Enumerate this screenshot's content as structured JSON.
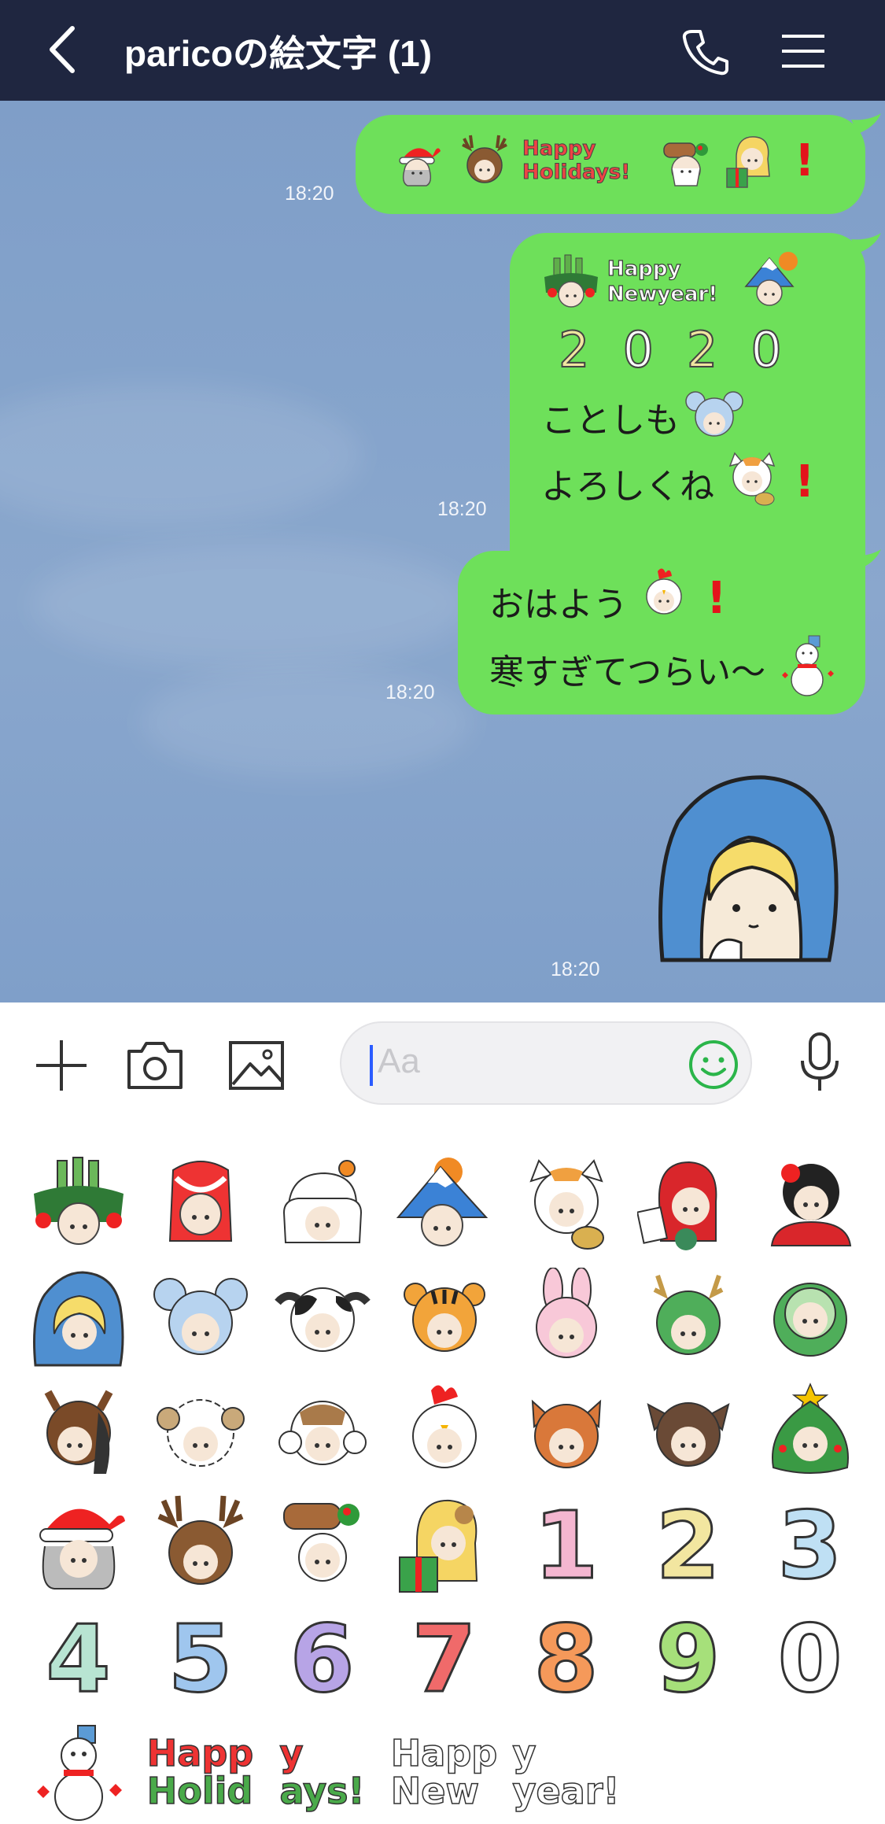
{
  "header": {
    "title": "paricoの絵文字 (1)",
    "back_icon": "chevron-left-icon",
    "call_icon": "phone-icon",
    "menu_icon": "hamburger-menu-icon"
  },
  "messages": [
    {
      "time": "18:20",
      "banner": "Happy Holidays!"
    },
    {
      "time": "18:20",
      "banner": "Happy Newyear!",
      "year": [
        "2",
        "0",
        "2",
        "0"
      ],
      "line1": "ことしも",
      "line2": "よろしくね"
    },
    {
      "time": "18:20",
      "line1": "おはよう",
      "line2": "寒すぎてつらい〜"
    },
    {
      "time": "18:20"
    }
  ],
  "input": {
    "placeholder": "Aa",
    "plus_icon": "plus-icon",
    "camera_icon": "camera-icon",
    "image_icon": "image-icon",
    "emoji_icon": "smiley-icon",
    "mic_icon": "microphone-icon"
  },
  "keyboard": {
    "digits": [
      "1",
      "2",
      "3",
      "4",
      "5",
      "6",
      "7",
      "8",
      "9",
      "0"
    ],
    "words": [
      "Happ",
      "Holid",
      "y",
      "ays!",
      "Happ",
      "New",
      "y",
      "year!"
    ]
  },
  "colors": {
    "header_bg": "#1f2640",
    "bubble": "#6ee05a",
    "accent_green": "#2bb54a",
    "exclaim_red": "#e3141b"
  }
}
